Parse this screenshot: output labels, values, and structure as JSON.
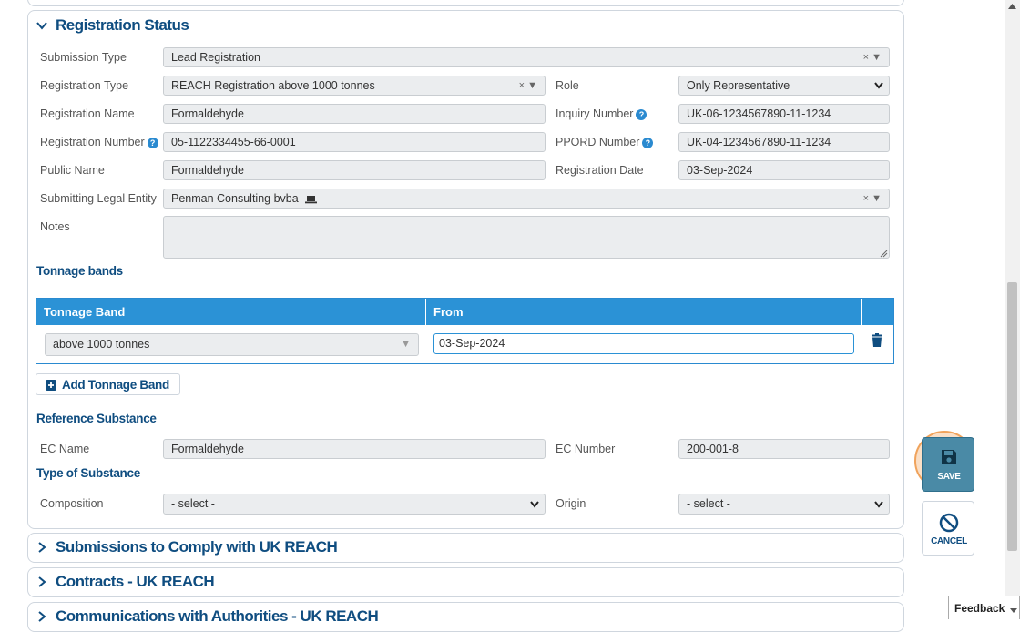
{
  "registration_status": {
    "title": "Registration Status",
    "submission_type": {
      "label": "Submission Type",
      "value": "Lead Registration"
    },
    "registration_type": {
      "label": "Registration Type",
      "value": "REACH Registration above 1000 tonnes"
    },
    "role": {
      "label": "Role",
      "value": "Only Representative"
    },
    "registration_name": {
      "label": "Registration Name",
      "value": "Formaldehyde"
    },
    "inquiry_number": {
      "label": "Inquiry Number",
      "value": "UK-06-1234567890-11-1234"
    },
    "registration_number": {
      "label": "Registration Number",
      "value": "05-1122334455-66-0001"
    },
    "ppord_number": {
      "label": "PPORD Number",
      "value": "UK-04-1234567890-11-1234"
    },
    "public_name": {
      "label": "Public Name",
      "value": "Formaldehyde"
    },
    "registration_date": {
      "label": "Registration Date",
      "value": "03-Sep-2024"
    },
    "submitting_legal_entity": {
      "label": "Submitting Legal Entity",
      "value": "Penman Consulting bvba"
    },
    "notes": {
      "label": "Notes",
      "value": ""
    },
    "clear_symbol": "×"
  },
  "tonnage": {
    "title": "Tonnage bands",
    "columns": [
      "Tonnage Band",
      "From"
    ],
    "rows": [
      {
        "band": "above 1000 tonnes",
        "from": "03-Sep-2024"
      }
    ],
    "add_label": "Add Tonnage Band"
  },
  "reference_substance": {
    "title": "Reference Substance",
    "ec_name": {
      "label": "EC Name",
      "value": "Formaldehyde"
    },
    "ec_number": {
      "label": "EC Number",
      "value": "200-001-8"
    }
  },
  "type_of_substance": {
    "title": "Type of Substance",
    "composition": {
      "label": "Composition",
      "value": "- select -"
    },
    "origin": {
      "label": "Origin",
      "value": "- select -"
    }
  },
  "collapsed_sections": [
    "Submissions to Comply with UK REACH",
    "Contracts - UK REACH",
    "Communications with Authorities - UK REACH"
  ],
  "actions": {
    "save": "SAVE",
    "cancel": "CANCEL",
    "feedback": "Feedback"
  },
  "colors": {
    "accent": "#2b92d6",
    "heading": "#0f4d80",
    "save_bg": "#4a8aa6",
    "highlight_ring": "#f0a35c"
  }
}
